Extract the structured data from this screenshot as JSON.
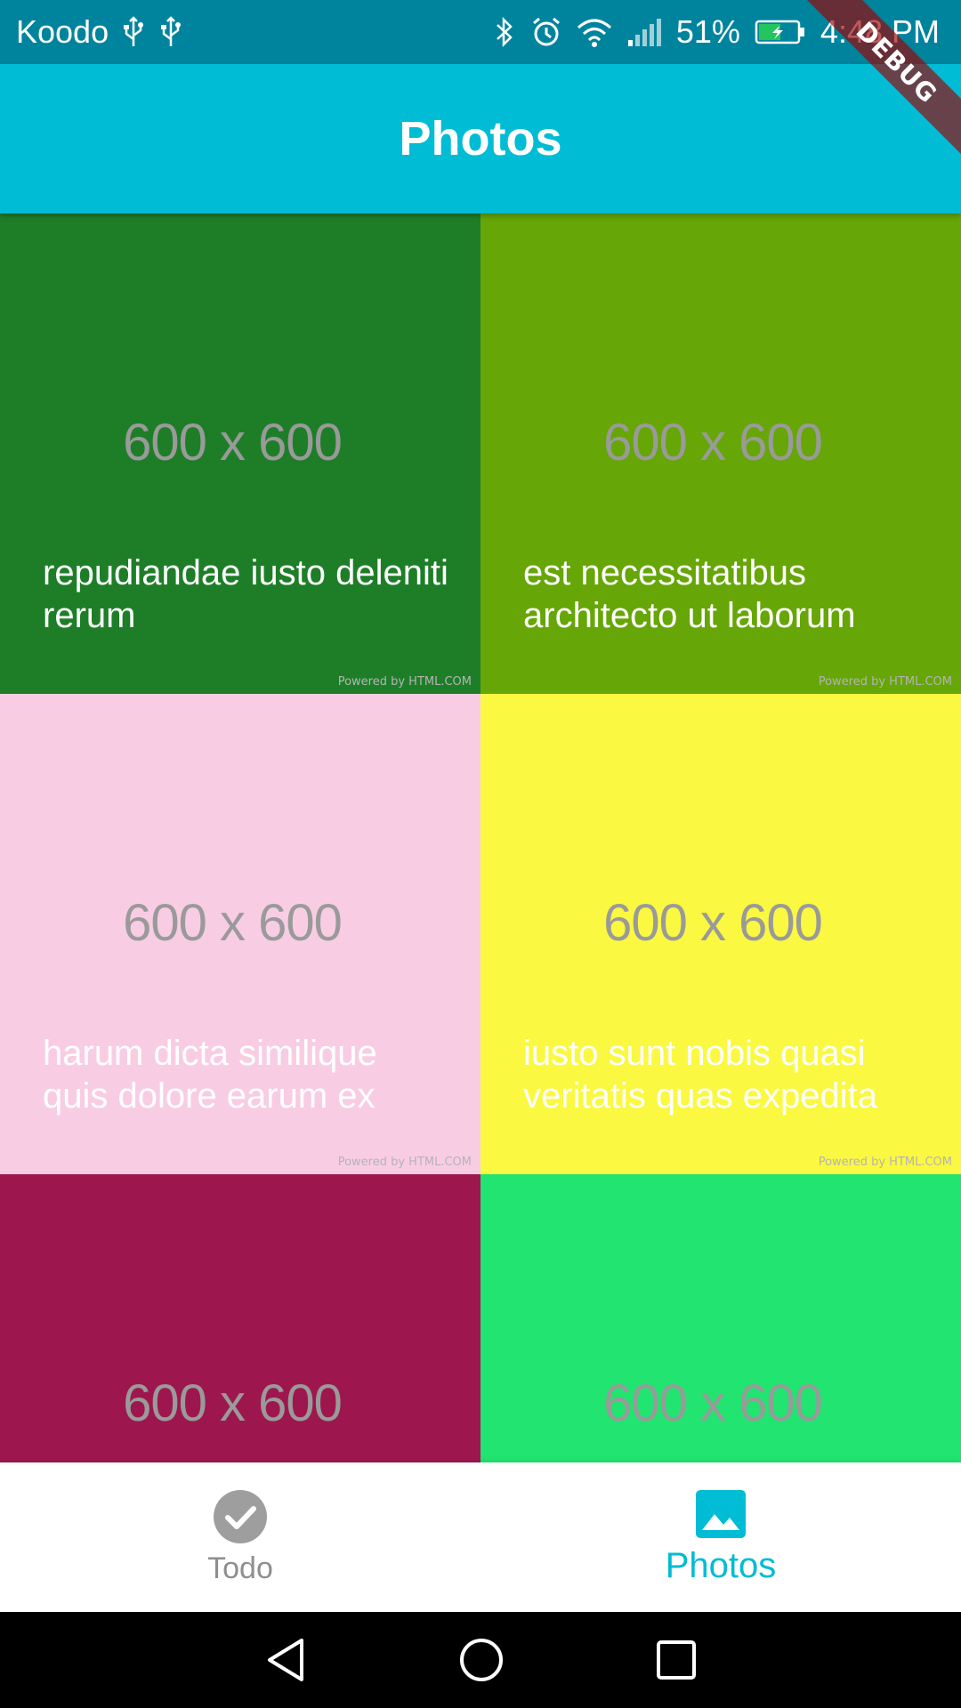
{
  "status_bar": {
    "carrier": "Koodo",
    "battery_percent": "51%",
    "time": "4:48 PM",
    "icons": [
      "usb-icon",
      "usb-icon",
      "bluetooth-icon",
      "alarm-icon",
      "wifi-icon",
      "signal-icon",
      "battery-charging-icon"
    ]
  },
  "app_bar": {
    "title": "Photos",
    "color": "#00bcd4"
  },
  "debug_banner": {
    "label": "DEBUG"
  },
  "photos": [
    {
      "size_label": "600 x 600",
      "caption": "repudiandae iusto deleniti rerum",
      "powered": "Powered by HTML.COM",
      "color": "#1e7e28"
    },
    {
      "size_label": "600 x 600",
      "caption": "est necessitatibus architecto ut laborum",
      "powered": "Powered by HTML.COM",
      "color": "#66a607"
    },
    {
      "size_label": "600 x 600",
      "caption": "harum dicta similique quis dolore earum ex",
      "powered": "Powered by HTML.COM",
      "color": "#f8cde4"
    },
    {
      "size_label": "600 x 600",
      "caption": "iusto sunt nobis quasi veritatis quas expedita",
      "powered": "Powered by HTML.COM",
      "color": "#fbf841"
    },
    {
      "size_label": "600 x 600",
      "caption": "",
      "powered": "",
      "color": "#9d174e"
    },
    {
      "size_label": "600 x 600",
      "caption": "",
      "powered": "",
      "color": "#22e470"
    }
  ],
  "bottom_nav": {
    "items": [
      {
        "label": "Todo",
        "icon": "check-circle-icon",
        "active": false
      },
      {
        "label": "Photos",
        "icon": "image-icon",
        "active": true
      }
    ],
    "active_color": "#00bcd4",
    "inactive_color": "#8f8f8f"
  },
  "system_nav": {
    "buttons": [
      "back-icon",
      "home-icon",
      "recents-icon"
    ]
  }
}
